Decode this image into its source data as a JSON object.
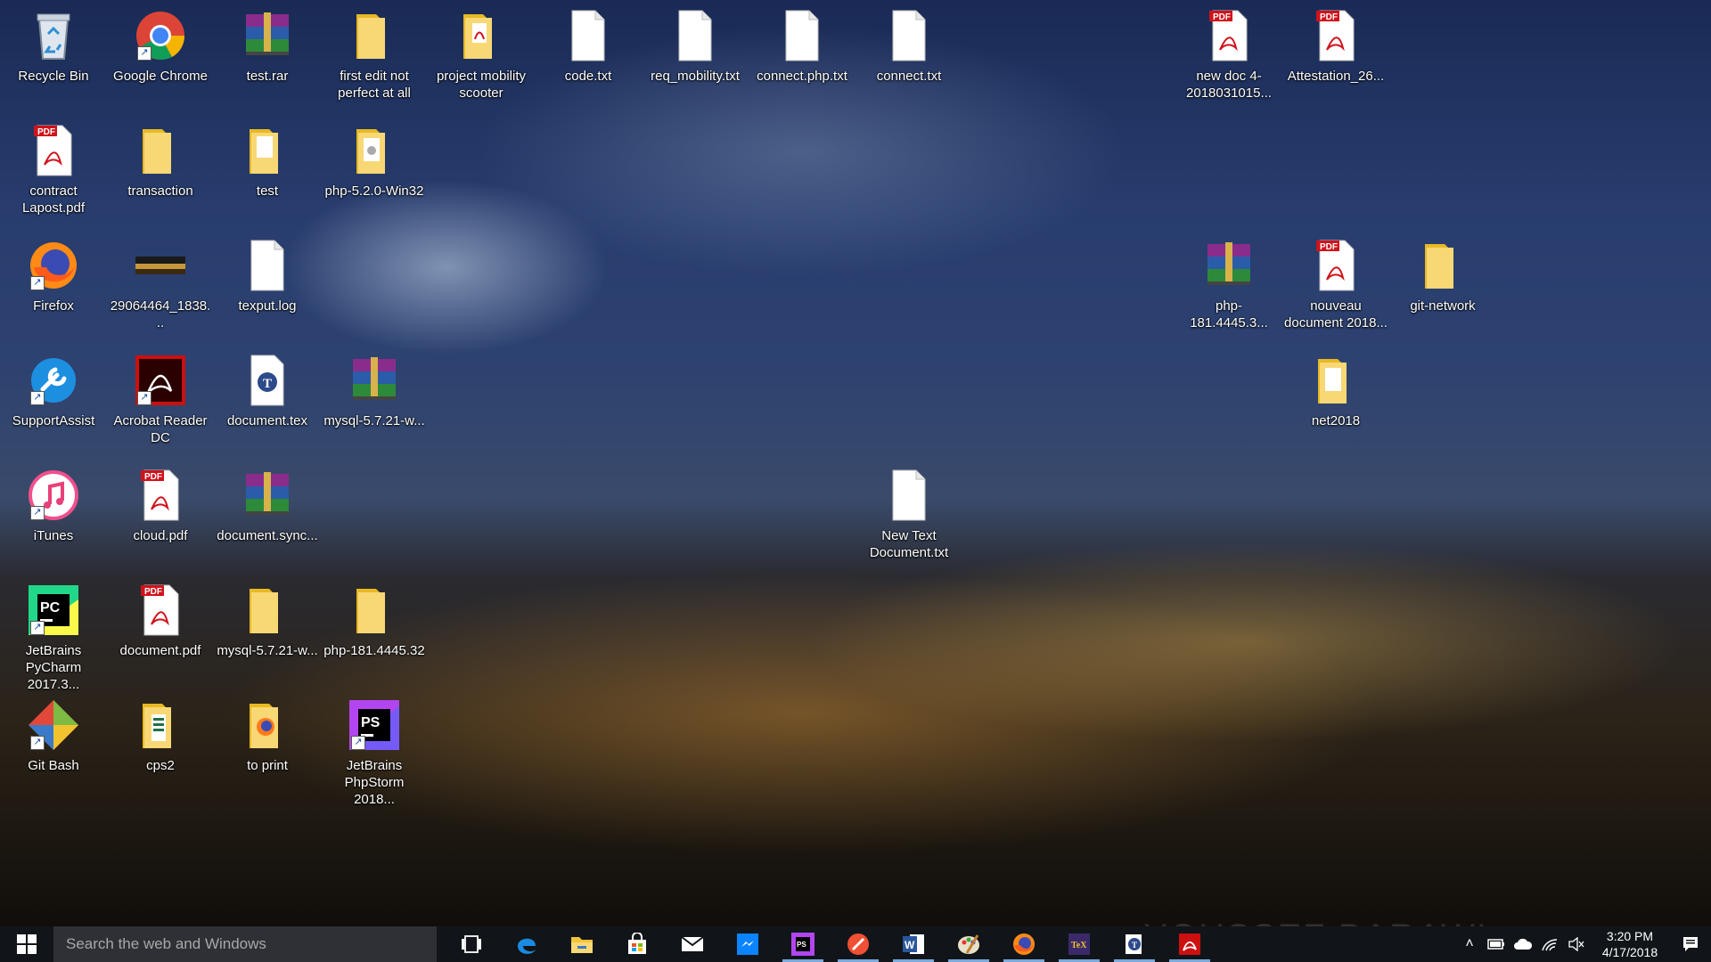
{
  "desktop": {
    "icons": {
      "recycle_bin": "Recycle Bin",
      "google_chrome": "Google Chrome",
      "test_rar": "test.rar",
      "first_edit": "first edit not perfect at all",
      "project_mobility": "project mobility scooter",
      "code_txt": "code.txt",
      "req_mobility": "req_mobility.txt",
      "connect_php": "connect.php.txt",
      "connect_txt": "connect.txt",
      "new_doc": "new doc 4-2018031015...",
      "attestation": "Attestation_26...",
      "contract": "contract Lapost.pdf",
      "transaction": "transaction",
      "test": "test",
      "php520": "php-5.2.0-Win32",
      "firefox": "Firefox",
      "image29064464": "29064464_1838...",
      "texput": "texput.log",
      "php181": "php-181.4445.3...",
      "nouveau": "nouveau document 2018...",
      "git_network": "git-network",
      "supportassist": "SupportAssist",
      "acrobat": "Acrobat Reader DC",
      "document_tex": "document.tex",
      "mysql_rar": "mysql-5.7.21-w...",
      "net2018": "net2018",
      "itunes": "iTunes",
      "cloud_pdf": "cloud.pdf",
      "document_sync": "document.sync...",
      "new_text": "New Text Document.txt",
      "pycharm": "JetBrains PyCharm 2017.3...",
      "document_pdf": "document.pdf",
      "mysql_folder": "mysql-5.7.21-w...",
      "php181_folder": "php-181.4445.32",
      "git_bash": "Git Bash",
      "cps2": "cps2",
      "to_print": "to print",
      "phpstorm": "JetBrains PhpStorm 2018..."
    }
  },
  "taskbar": {
    "search_placeholder": "Search the web and Windows",
    "apps": [
      "Task View",
      "Microsoft Edge",
      "File Explorer",
      "Store",
      "Mail",
      "Messenger",
      "PhpStorm",
      "Git",
      "Word",
      "Paint",
      "Firefox",
      "TeX",
      "TeXworks",
      "Acrobat Reader"
    ],
    "clock_time": "3:20 PM",
    "clock_date": "4/17/2018",
    "watermark": "YOUSSEF BARAWI"
  },
  "colors": {
    "taskbar_bg": "#111519",
    "search_bg": "#2e3035",
    "running_indicator": "#7aa9dc",
    "pdf_red": "#d0121b"
  }
}
